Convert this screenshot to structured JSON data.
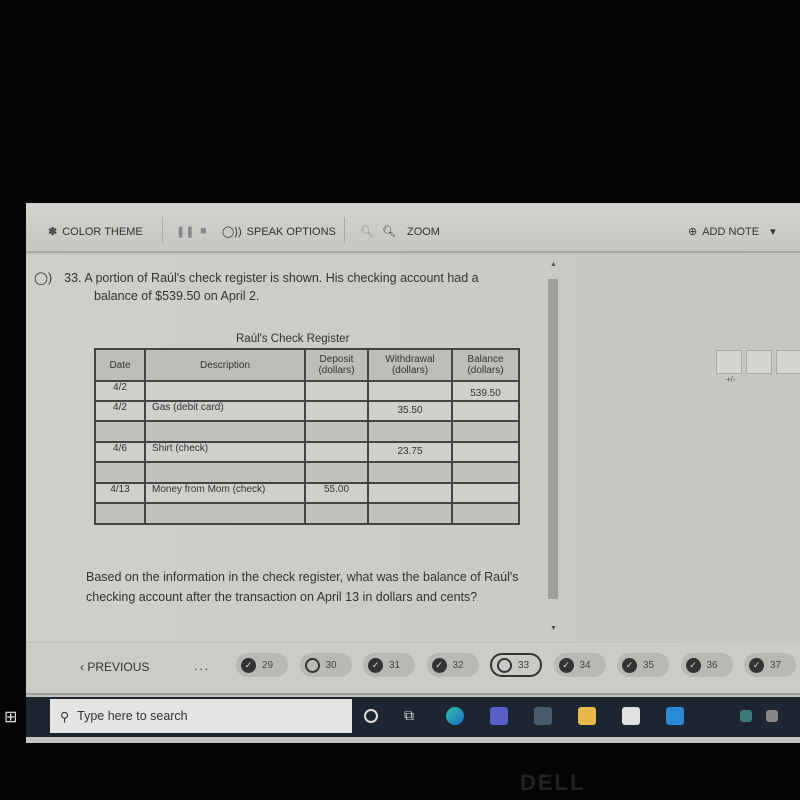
{
  "toolbar": {
    "color_theme": "COLOR THEME",
    "speak_options": "SPEAK OPTIONS",
    "zoom": "ZOOM",
    "add_note": "ADD NOTE"
  },
  "question": {
    "number": "33.",
    "text_line1": "A portion of Raúl's check register is shown. His checking account had a",
    "text_line2": "balance of $539.50 on April 2.",
    "prompt": "Based on the information in the check register, what was the balance of Raúl's checking account after the transaction on April 13 in dollars and cents?"
  },
  "register": {
    "title": "Raúl's Check Register",
    "headers": [
      "Date",
      "Description",
      "Deposit (dollars)",
      "Withdrawal (dollars)",
      "Balance (dollars)"
    ],
    "rows": [
      {
        "date": "4/2",
        "description": "",
        "deposit": "",
        "withdrawal": "",
        "balance": "539.50"
      },
      {
        "date": "4/2",
        "description": "Gas (debit card)",
        "deposit": "",
        "withdrawal": "35.50",
        "balance": ""
      },
      {
        "date": "4/6",
        "description": "Shirt (check)",
        "deposit": "",
        "withdrawal": "23.75",
        "balance": ""
      },
      {
        "date": "4/13",
        "description": "Money from Mom (check)",
        "deposit": "55.00",
        "withdrawal": "",
        "balance": ""
      }
    ]
  },
  "answer": {
    "sign_label": "+/-"
  },
  "nav": {
    "previous": "PREVIOUS",
    "ellipsis": "...",
    "items": [
      {
        "n": "29",
        "done": true
      },
      {
        "n": "30",
        "done": false
      },
      {
        "n": "31",
        "done": true
      },
      {
        "n": "32",
        "done": true
      },
      {
        "n": "33",
        "done": false,
        "current": true
      },
      {
        "n": "34",
        "done": true
      },
      {
        "n": "35",
        "done": true
      },
      {
        "n": "36",
        "done": true
      },
      {
        "n": "37",
        "done": true
      }
    ]
  },
  "taskbar": {
    "search_placeholder": "Type here to search"
  },
  "bezel": {
    "brand": "DELL"
  }
}
